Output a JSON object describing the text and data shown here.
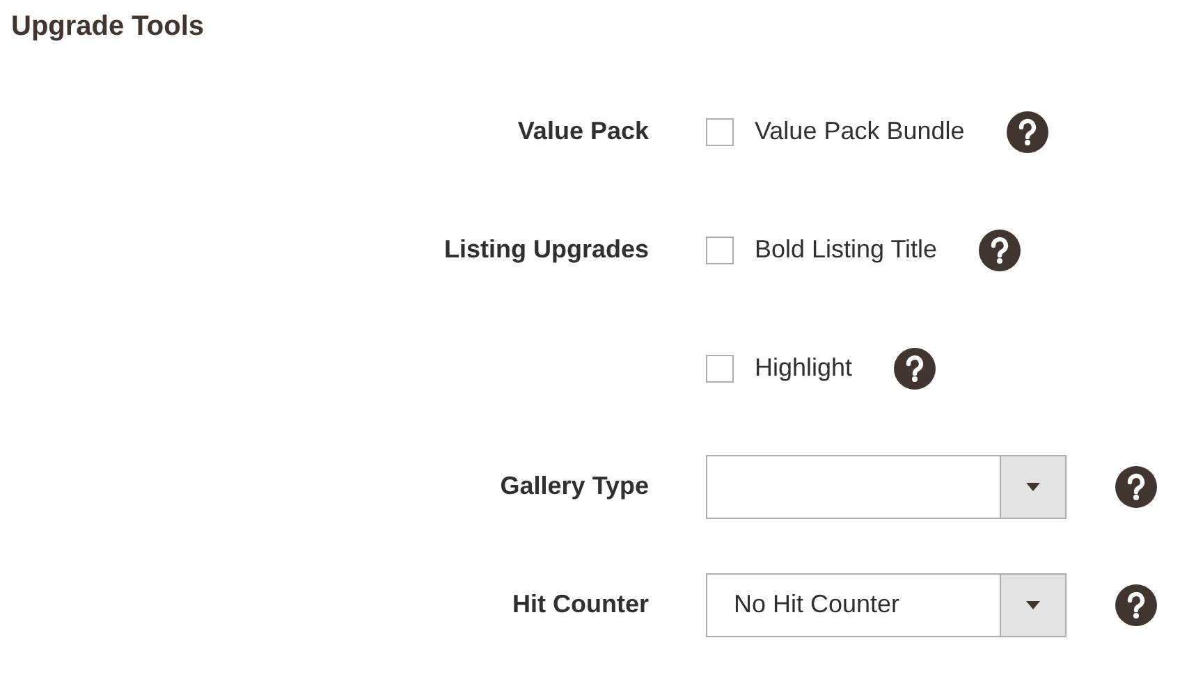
{
  "title": "Upgrade Tools",
  "rows": [
    {
      "label": "Value Pack",
      "kind": "checkbox",
      "option": "Value Pack Bundle",
      "checked": false
    },
    {
      "label": "Listing Upgrades",
      "kind": "checkbox",
      "option": "Bold Listing Title",
      "checked": false
    },
    {
      "kind": "checkbox",
      "option": "Highlight",
      "checked": false
    },
    {
      "label": "Gallery Type",
      "kind": "select"
    },
    {
      "label": "Hit Counter",
      "kind": "select",
      "value": "No Hit Counter"
    }
  ]
}
